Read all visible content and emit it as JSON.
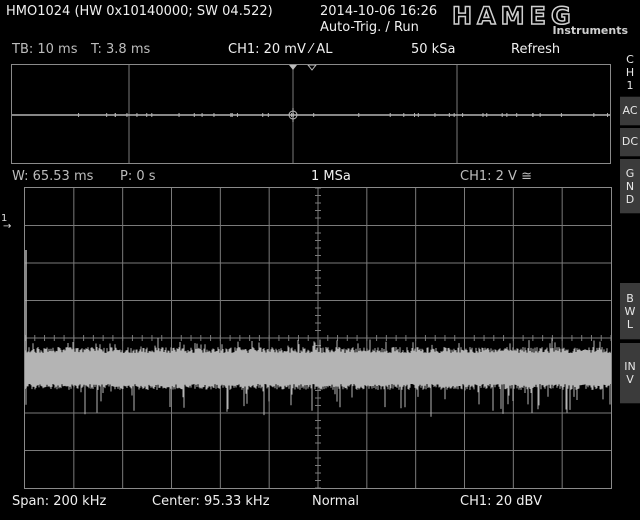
{
  "header": {
    "device_info": "HMO1024 (HW 0x10140000; SW 04.522)",
    "datetime": "2014-10-06 16:26",
    "trigger_status": "Auto-Trig. / Run",
    "brand": "HAMEG",
    "brand_sub": "Instruments"
  },
  "top_status": {
    "timebase": "TB: 10 ms",
    "trigger_time": "T: 3.8 ms",
    "channel_setting": "CH1: 20 mV ⁄ AL",
    "sample_rate": "50 kSa",
    "mode": "Refresh"
  },
  "mid_status": {
    "window": "W: 65.53 ms",
    "position": "P: 0 s",
    "sample_rate": "1 MSa",
    "channel_scale": "CH1: 2 V ≅"
  },
  "bottom_status": {
    "span": "Span: 200 kHz",
    "center": "Center: 95.33 kHz",
    "mode": "Normal",
    "ref_level": "CH1: 20 dBV"
  },
  "side_buttons": {
    "ch1": "CH1",
    "ac": "AC",
    "dc": "DC",
    "gnd": "GND",
    "bwl": "BWL",
    "inv": "INV"
  },
  "markers": {
    "channel_marker": "1"
  },
  "colors": {
    "background": "#000000",
    "trace": "#b4b4b4",
    "grid": "#7a7a7a",
    "button": "#3b3b3b"
  }
}
